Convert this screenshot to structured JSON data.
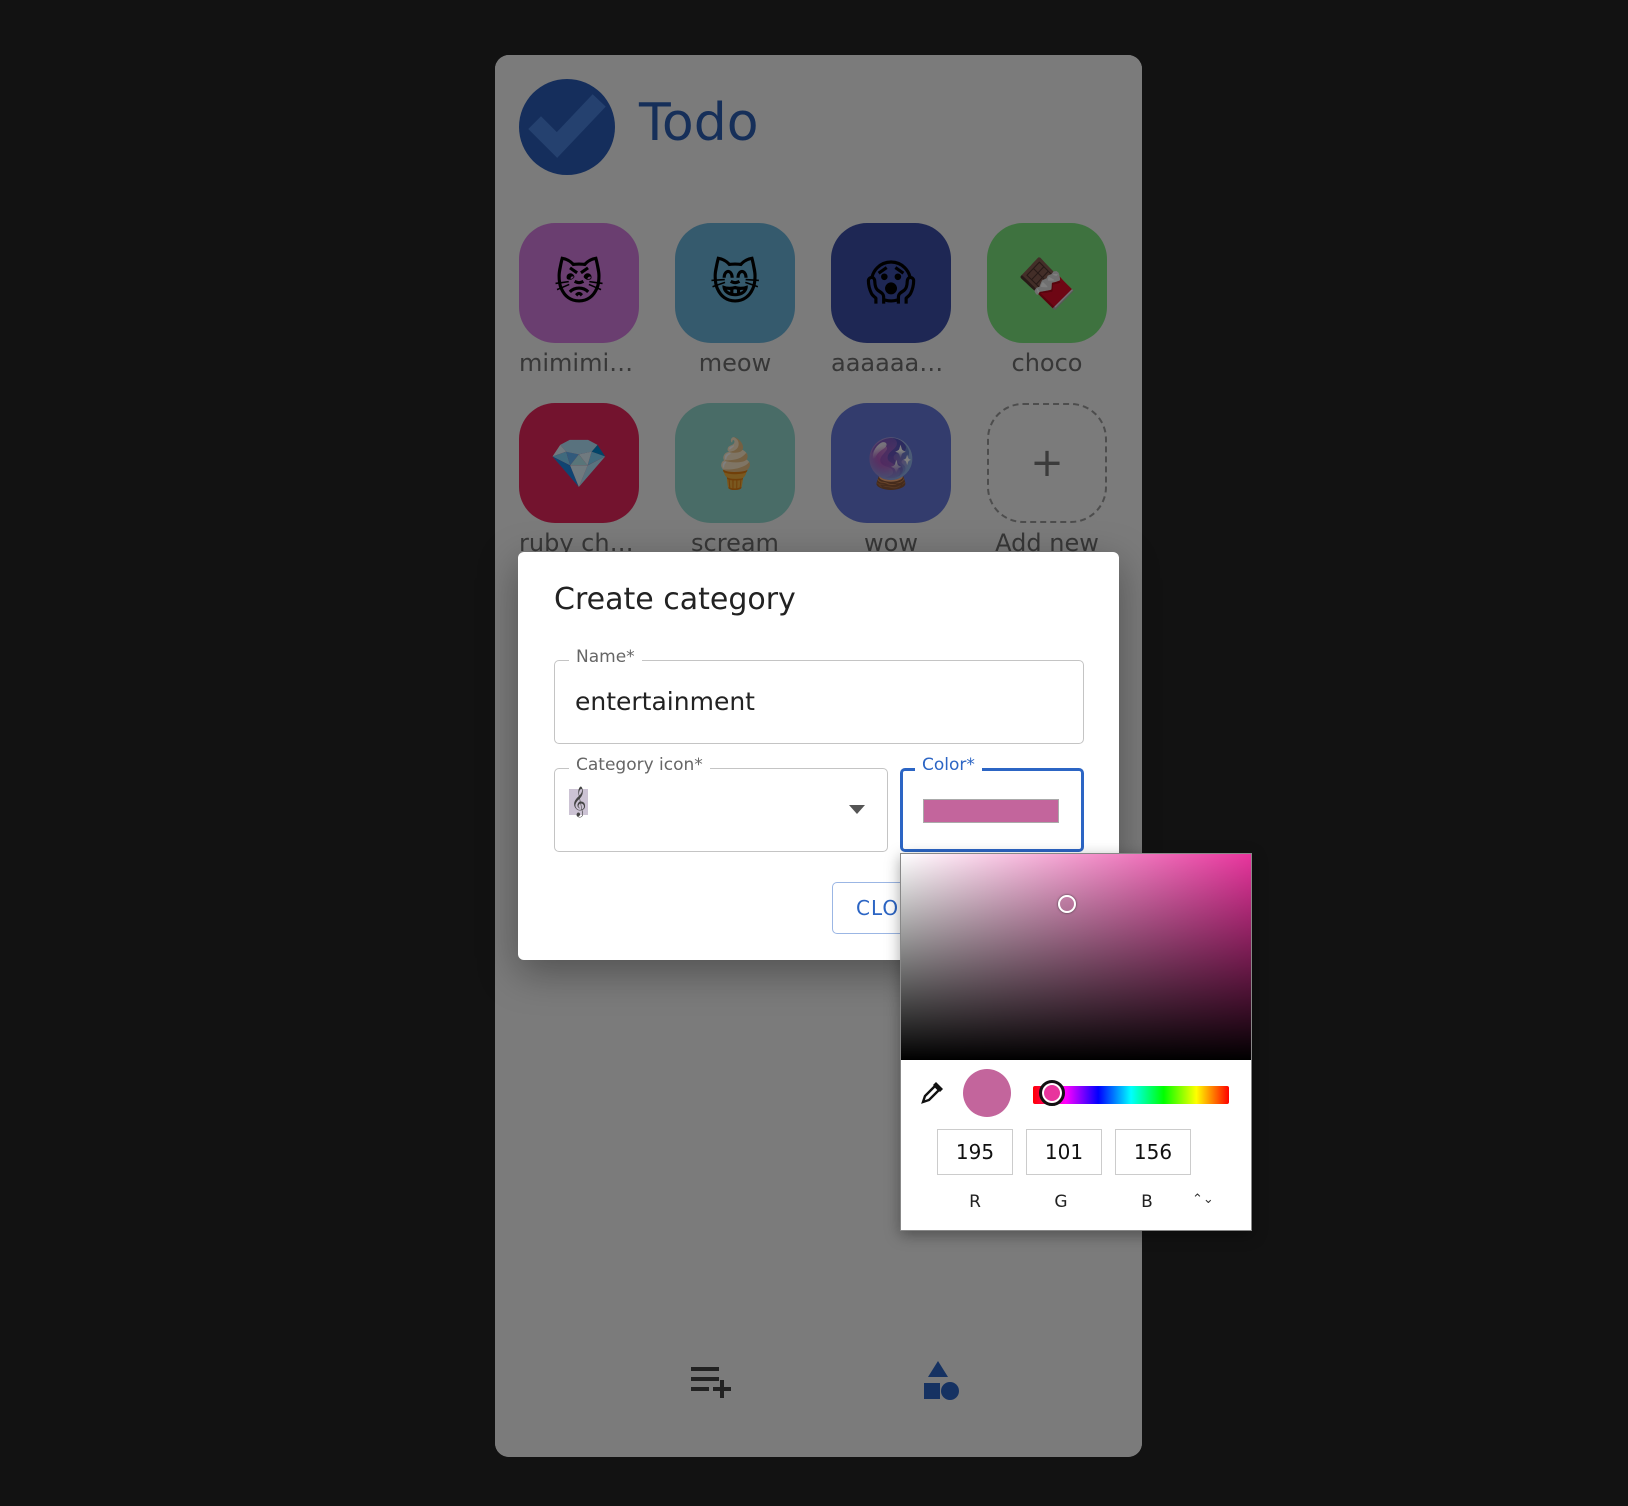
{
  "app": {
    "title": "Todo"
  },
  "categories": [
    {
      "label": "mimimimi",
      "icon": "😾",
      "color": "#d57de0"
    },
    {
      "label": "meow",
      "icon": "😸",
      "color": "#6bb5da"
    },
    {
      "label": "aaaaaaa...",
      "icon": "😱",
      "color": "#3d4fa8"
    },
    {
      "label": "choco",
      "icon": "🍫",
      "color": "#7de57f"
    },
    {
      "label": "ruby chan",
      "icon": "💎",
      "color": "#e7275c"
    },
    {
      "label": "scream",
      "icon": "🍦",
      "color": "#93d8ce"
    },
    {
      "label": "wow",
      "icon": "🔮",
      "color": "#6679da"
    }
  ],
  "add_new": {
    "label": "Add new",
    "icon": "+"
  },
  "dialog": {
    "title": "Create category",
    "name_label": "Name*",
    "name_value": "entertainment",
    "icon_label": "Category icon*",
    "icon_value": "𝄞",
    "color_label": "Color*",
    "close_label": "CLOSE"
  },
  "color_picker": {
    "color": "#c3659c",
    "r": "195",
    "g": "101",
    "b": "156",
    "r_label": "R",
    "g_label": "G",
    "b_label": "B",
    "swap_icon": "⌃⌄"
  },
  "nav": {
    "icons": [
      "playlist-add-icon",
      "category-shapes-icon"
    ]
  }
}
